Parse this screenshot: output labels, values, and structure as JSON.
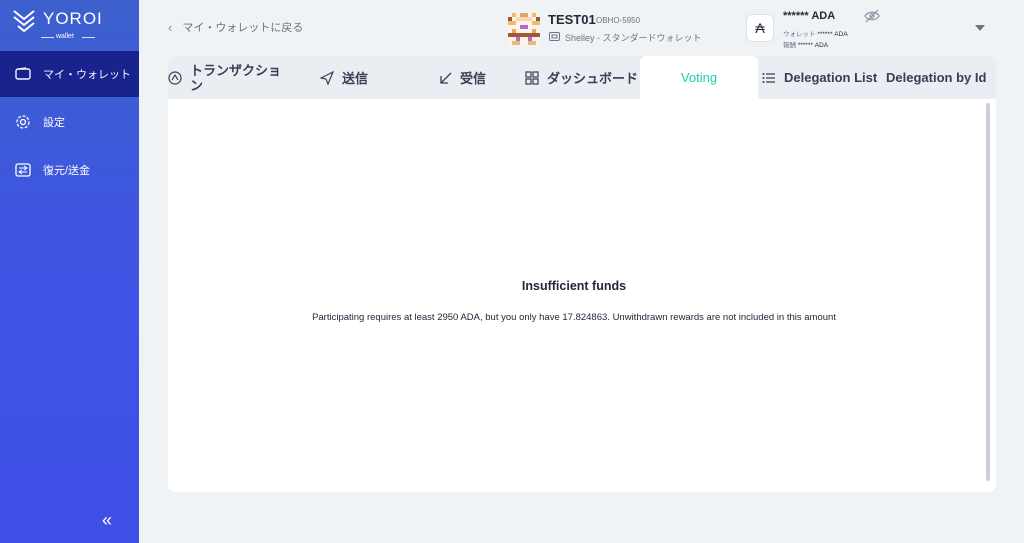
{
  "sidebar": {
    "brand": "YOROI",
    "brand_sub": "wallet",
    "items": [
      {
        "label": "マイ・ウォレット",
        "icon": "wallet-icon",
        "active": true
      },
      {
        "label": "設定",
        "icon": "gear-icon",
        "active": false
      },
      {
        "label": "復元/送金",
        "icon": "transfer-icon",
        "active": false
      }
    ],
    "collapse_label": "«"
  },
  "header": {
    "back_label": "マイ・ウォレットに戻る",
    "wallet_name": "TEST01",
    "wallet_plate": "OBHO-5950",
    "wallet_type": "Shelley - スタンダードウォレット",
    "ada_symbol": "₳",
    "balance": "****** ADA",
    "wallet_balance_label": "ウォレット",
    "wallet_balance_value": "****** ADA",
    "rewards_label": "報酬",
    "rewards_value": "****** ADA"
  },
  "tabs": [
    {
      "label": "トランザクション",
      "icon": "transactions-icon"
    },
    {
      "label": "送信",
      "icon": "send-icon"
    },
    {
      "label": "受信",
      "icon": "receive-icon"
    },
    {
      "label": "ダッシュボード",
      "icon": "dashboard-icon"
    },
    {
      "label": "Voting",
      "icon": "",
      "active": true
    },
    {
      "label": "Delegation List",
      "icon": "list-icon"
    },
    {
      "label": "Delegation by Id",
      "icon": ""
    }
  ],
  "content": {
    "title": "Insufficient funds",
    "message": "Participating requires at least 2950 ADA, but you only have 17.824863. Unwithdrawn rewards are not included in this amount"
  },
  "colors": {
    "sidebar_top": "#3d60cd",
    "sidebar_bottom": "#3e4fe6",
    "active_item": "#17208a",
    "active_tab": "#17d1aa"
  }
}
